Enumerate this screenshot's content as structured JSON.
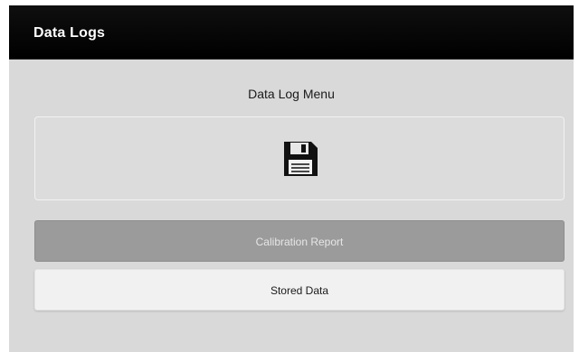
{
  "window": {
    "title": "Data Logs"
  },
  "menu": {
    "heading": "Data Log Menu",
    "icon": "floppy-disk-icon",
    "buttons": [
      {
        "label": "Calibration Report",
        "state": "disabled"
      },
      {
        "label": "Stored Data",
        "state": "enabled"
      }
    ]
  },
  "colors": {
    "titlebar": "#000000",
    "background": "#d9d9d9",
    "disabled_button": "#9b9b9b",
    "enabled_button": "#f1f1f1"
  }
}
